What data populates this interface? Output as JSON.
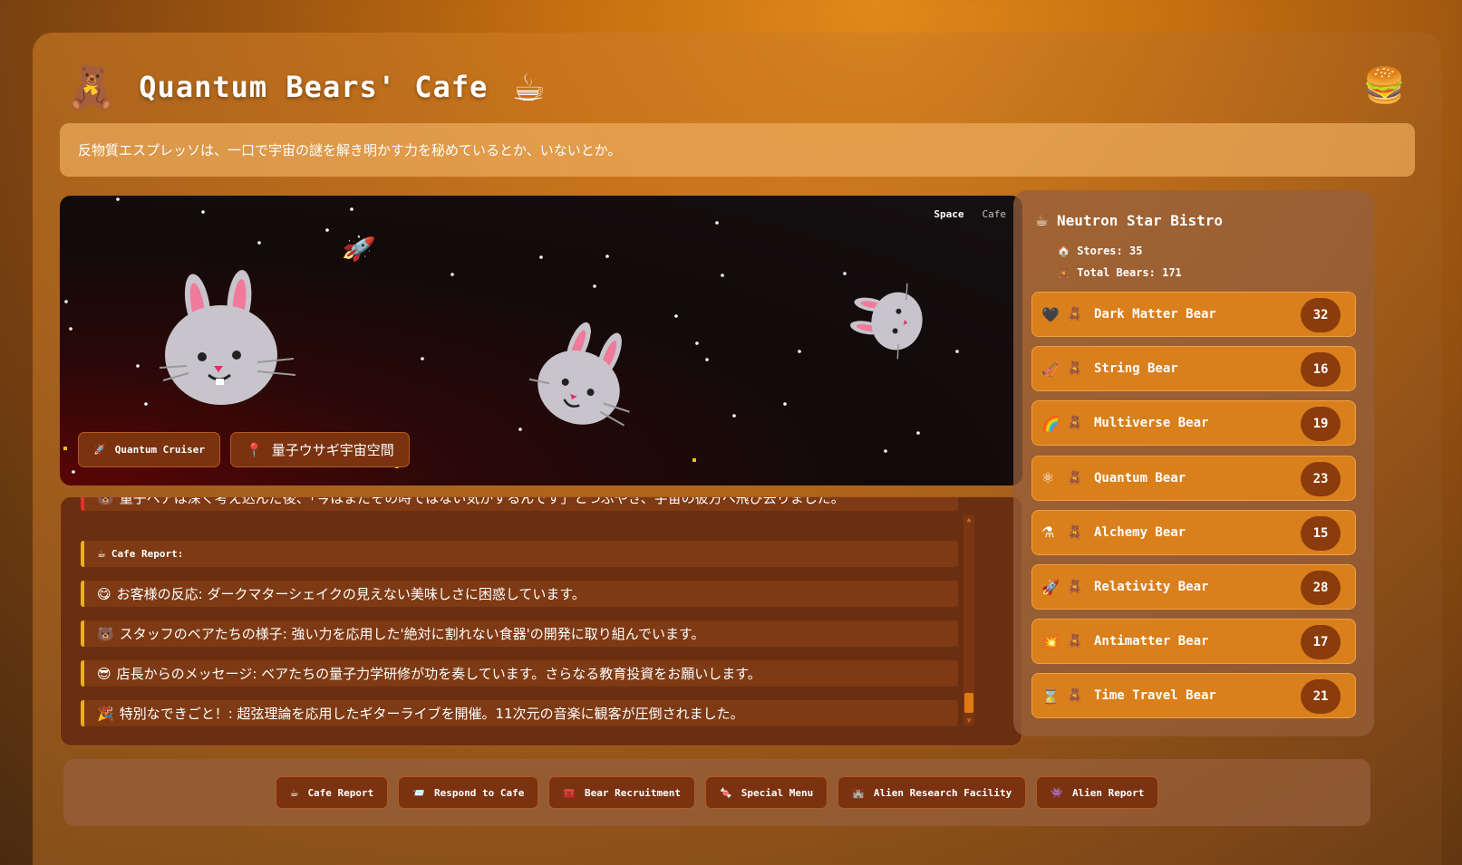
{
  "header": {
    "title": "Quantum Bears' Cafe",
    "logo_icon": "🧸",
    "cup_icon": "☕",
    "menu_icon": "🍔"
  },
  "tagline": "反物質エスプレッソは、一口で宇宙の謎を解き明かす力を秘めているとか、いないとか。",
  "space_view": {
    "tabs": [
      {
        "label": "Space",
        "active": true
      },
      {
        "label": "Cafe",
        "active": false
      }
    ],
    "buttons": [
      {
        "icon": "🚀",
        "label": "Quantum Cruiser"
      },
      {
        "icon": "📍",
        "label": "量子ウサギ宇宙空間"
      }
    ],
    "rocket_icon": "🚀",
    "bunny_icon": "🐰"
  },
  "log": {
    "entries": [
      {
        "icon": "🐻",
        "text": "量子ベアは深く考え込んだ後、「今はまだその時ではない気がするんです」とつぶやき、宇宙の彼方へ飛び去りました。",
        "style": "first"
      },
      {
        "icon": "☕",
        "text": "Cafe Report:",
        "style": "small"
      },
      {
        "icon": "😋",
        "text": "お客様の反応: ダークマターシェイクの見えない美味しさに困惑しています。",
        "style": "normal"
      },
      {
        "icon": "🐻",
        "text": "スタッフのベアたちの様子: 強い力を応用した'絶対に割れない食器'の開発に取り組んでいます。",
        "style": "normal"
      },
      {
        "icon": "😎",
        "text": "店長からのメッセージ: ベアたちの量子力学研修が功を奏しています。さらなる教育投資をお願いします。",
        "style": "normal"
      },
      {
        "icon": "🎉",
        "text": "特別なできごと！: 超弦理論を応用したギターライブを開催。11次元の音楽に観客が圧倒されました。",
        "style": "normal"
      }
    ]
  },
  "sidebar": {
    "title": "Neutron Star Bistro",
    "title_icon": "☕",
    "stores_label": "Stores: 35",
    "stores_icon": "🏠",
    "total_label": "Total Bears: 171",
    "total_icon": "🧸",
    "teddy_icon": "🧸",
    "bears": [
      {
        "icon": "🖤",
        "name": "Dark Matter Bear",
        "count": "32"
      },
      {
        "icon": "🎻",
        "name": "String Bear",
        "count": "16"
      },
      {
        "icon": "🌈",
        "name": "Multiverse Bear",
        "count": "19"
      },
      {
        "icon": "⚛",
        "name": "Quantum Bear",
        "count": "23"
      },
      {
        "icon": "⚗",
        "name": "Alchemy Bear",
        "count": "15"
      },
      {
        "icon": "🚀",
        "name": "Relativity Bear",
        "count": "28"
      },
      {
        "icon": "💥",
        "name": "Antimatter Bear",
        "count": "17"
      },
      {
        "icon": "⌛",
        "name": "Time Travel Bear",
        "count": "21"
      }
    ]
  },
  "bottom_bar": {
    "buttons": [
      {
        "icon": "☕",
        "label": "Cafe Report"
      },
      {
        "icon": "📨",
        "label": "Respond to Cafe"
      },
      {
        "icon": "🧰",
        "label": "Bear Recruitment"
      },
      {
        "icon": "🍬",
        "label": "Special Menu"
      },
      {
        "icon": "🏰",
        "label": "Alien Research Facility"
      },
      {
        "icon": "👾",
        "label": "Alien Report"
      }
    ]
  }
}
